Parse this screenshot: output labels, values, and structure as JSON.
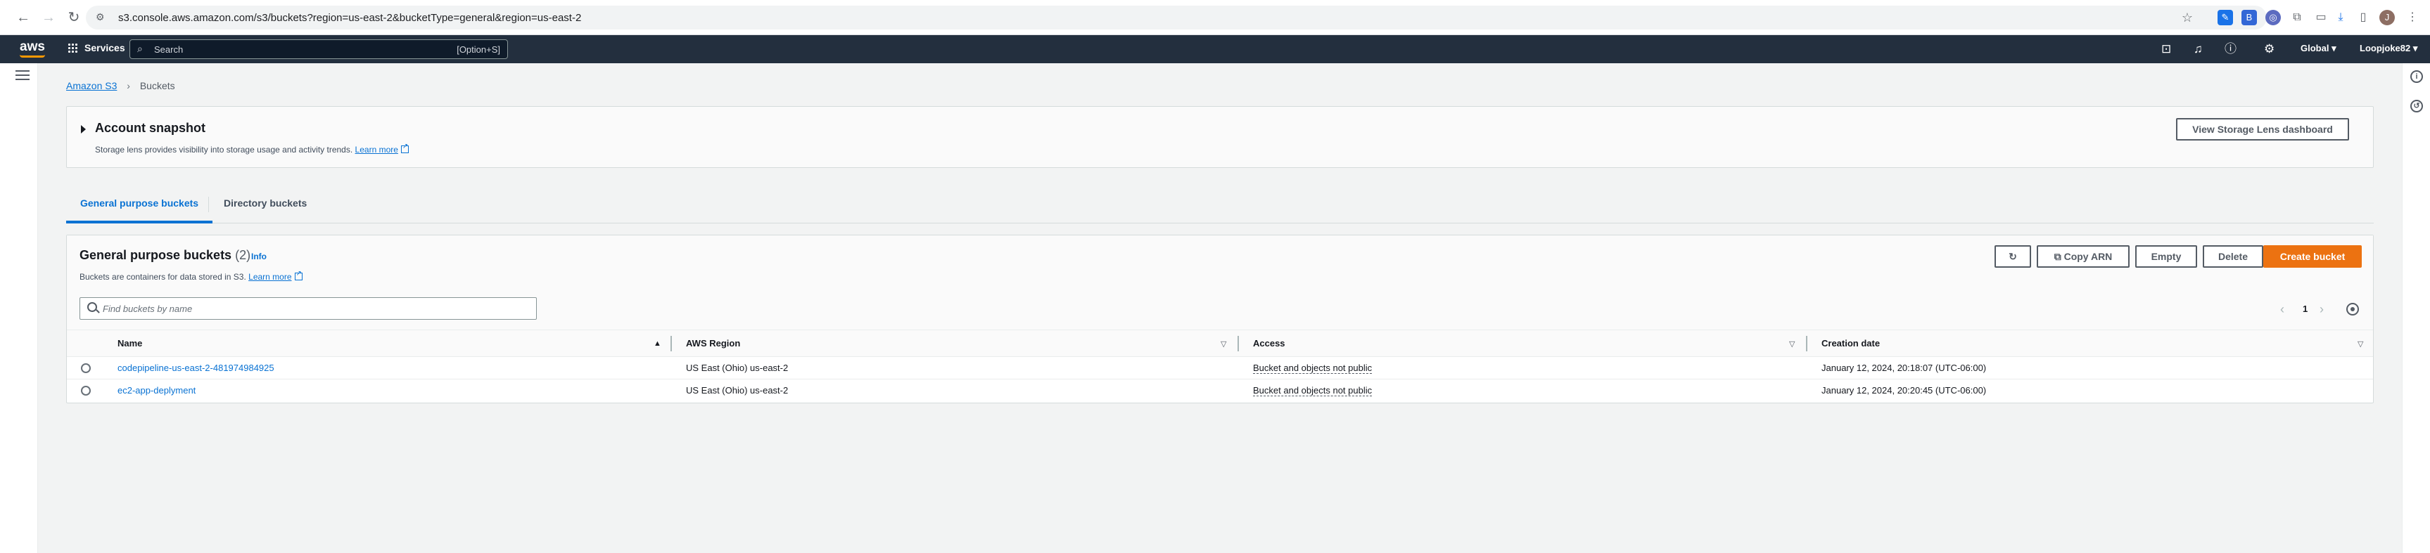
{
  "browser": {
    "url": "s3.console.aws.amazon.com/s3/buckets?region=us-east-2&bucketType=general&region=us-east-2"
  },
  "aws_nav": {
    "logo": "aws",
    "services_label": "Services",
    "search_placeholder": "Search",
    "search_shortcut": "[Option+S]",
    "region_label": "Global",
    "account_label": "Loopjoke82"
  },
  "breadcrumb": {
    "root": "Amazon S3",
    "current": "Buckets"
  },
  "snapshot": {
    "title": "Account snapshot",
    "description": "Storage lens provides visibility into storage usage and activity trends.",
    "learn_more": "Learn more",
    "dashboard_button": "View Storage Lens dashboard"
  },
  "tabs": [
    {
      "label": "General purpose buckets",
      "active": true
    },
    {
      "label": "Directory buckets",
      "active": false
    }
  ],
  "buckets_panel": {
    "title": "General purpose buckets",
    "count": "(2)",
    "info": "Info",
    "description": "Buckets are containers for data stored in S3.",
    "learn_more": "Learn more",
    "actions": {
      "refresh": "↻",
      "copy_arn": "Copy ARN",
      "empty": "Empty",
      "delete": "Delete",
      "create": "Create bucket"
    },
    "search_placeholder": "Find buckets by name",
    "page": "1"
  },
  "table": {
    "columns": [
      "Name",
      "AWS Region",
      "Access",
      "Creation date"
    ],
    "rows": [
      {
        "name": "codepipeline-us-east-2-481974984925",
        "region": "US East (Ohio) us-east-2",
        "access": "Bucket and objects not public",
        "created": "January 12, 2024, 20:18:07 (UTC-06:00)"
      },
      {
        "name": "ec2-app-deplyment",
        "region": "US East (Ohio) us-east-2",
        "access": "Bucket and objects not public",
        "created": "January 12, 2024, 20:20:45 (UTC-06:00)"
      }
    ]
  },
  "colors": {
    "aws_nav_bg": "#232f3e",
    "link": "#0972d3",
    "primary_button": "#ec7211"
  }
}
